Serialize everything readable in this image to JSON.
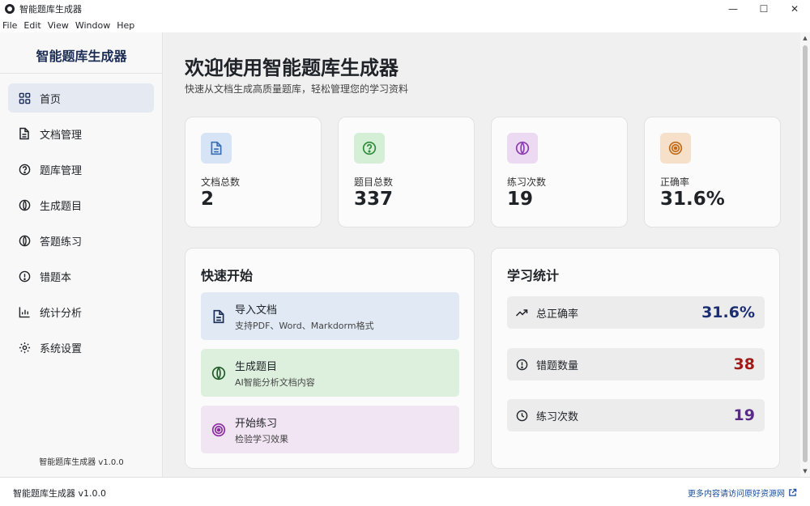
{
  "window": {
    "title": "智能题库生成器",
    "minimize_glyph": "—",
    "maximize_glyph": "☐",
    "close_glyph": "✕"
  },
  "menu": [
    "File",
    "Edit",
    "View",
    "Window",
    "Hep"
  ],
  "sidebar": {
    "title": "智能题库生成器",
    "items": [
      {
        "label": "首页",
        "icon": "grid-icon",
        "active": true
      },
      {
        "label": "文档管理",
        "icon": "document-icon"
      },
      {
        "label": "题库管理",
        "icon": "question-circle-icon"
      },
      {
        "label": "生成题目",
        "icon": "leaf-icon"
      },
      {
        "label": "答题练习",
        "icon": "leaf-icon"
      },
      {
        "label": "错题本",
        "icon": "alert-circle-icon"
      },
      {
        "label": "统计分析",
        "icon": "bar-chart-icon"
      },
      {
        "label": "系统设置",
        "icon": "gear-icon"
      }
    ],
    "version": "智能题库生成器 v1.0.0"
  },
  "main": {
    "title": "欢迎使用智能题库生成器",
    "subtitle": "快速从文档生成高质量题库，轻松管理您的学习资料",
    "stats": [
      {
        "label": "文档总数",
        "value": "2",
        "icon": "document-icon",
        "color": "#3b6fb5",
        "bg": "#d7e4f5"
      },
      {
        "label": "题目总数",
        "value": "337",
        "icon": "question-circle-icon",
        "color": "#2e8b3a",
        "bg": "#d4efd6"
      },
      {
        "label": "练习次数",
        "value": "19",
        "icon": "leaf-icon",
        "color": "#8a3bb0",
        "bg": "#ecdaf3"
      },
      {
        "label": "正确率",
        "value": "31.6%",
        "icon": "target-icon",
        "color": "#c06a1a",
        "bg": "#f6e0c9"
      }
    ],
    "quick_start": {
      "title": "快速开始",
      "items": [
        {
          "title": "导入文档",
          "desc": "支持PDF、Word、Markdorm格式",
          "icon": "document-icon",
          "bg": "#e1e9f4",
          "color": "#1c2e56"
        },
        {
          "title": "生成题目",
          "desc": "AI智能分析文档内容",
          "icon": "leaf-icon",
          "bg": "#dcf0dd",
          "color": "#1f5a27"
        },
        {
          "title": "开始练习",
          "desc": "检验学习效果",
          "icon": "target-icon",
          "bg": "#f1e4f3",
          "color": "#8a2b9e"
        }
      ]
    },
    "learning_stats": {
      "title": "学习统计",
      "items": [
        {
          "label": "总正确率",
          "value": "31.6%",
          "icon": "trend-up-icon",
          "color": "#1c2e73"
        },
        {
          "label": "错题数量",
          "value": "38",
          "icon": "alert-circle-icon",
          "color": "#a31919"
        },
        {
          "label": "练习次数",
          "value": "19",
          "icon": "clock-icon",
          "color": "#5a2a8a"
        }
      ]
    }
  },
  "statusbar": {
    "left": "智能题库生成器 v1.0.0",
    "right": "更多内容请访问原好资源网"
  }
}
